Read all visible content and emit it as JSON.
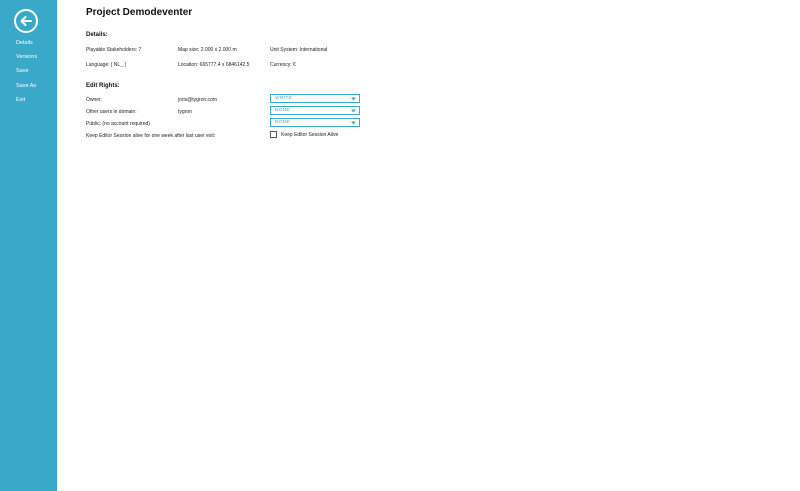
{
  "sidebar": {
    "items": [
      {
        "label": "Details"
      },
      {
        "label": "Versions"
      },
      {
        "label": "Save"
      },
      {
        "label": "Save As"
      },
      {
        "label": "Exit"
      }
    ]
  },
  "page": {
    "title": "Project Demodeventer"
  },
  "details": {
    "heading": "Details:",
    "stakeholders": "Playable Stakeholders: 7",
    "map_size": "Map size: 2.000 x 2.000 m",
    "unit_system": "Unit System: International",
    "language": "Language: [ NL_ ]",
    "location": "Location: 665777.4 x 6846142.5",
    "currency": "Currency: €"
  },
  "edit_rights": {
    "heading": "Edit Rights:",
    "owner": {
      "label": "Owner:",
      "value": "joris@tygron.com",
      "select": "WRITE"
    },
    "domain": {
      "label": "Other users in domain:",
      "value": "tygron",
      "select": "NONE"
    },
    "public": {
      "label": "Public: (no account required)",
      "select": "NONE"
    },
    "keep_session": {
      "label": "Keep Editor Session alive for one week after last user exit:",
      "checkbox_label": "Keep Editor Session Alive"
    }
  },
  "colors": {
    "accent": "#3aa8c8"
  },
  "icons": {
    "back": "back-arrow-icon",
    "chevron": "chevron-down-icon"
  }
}
